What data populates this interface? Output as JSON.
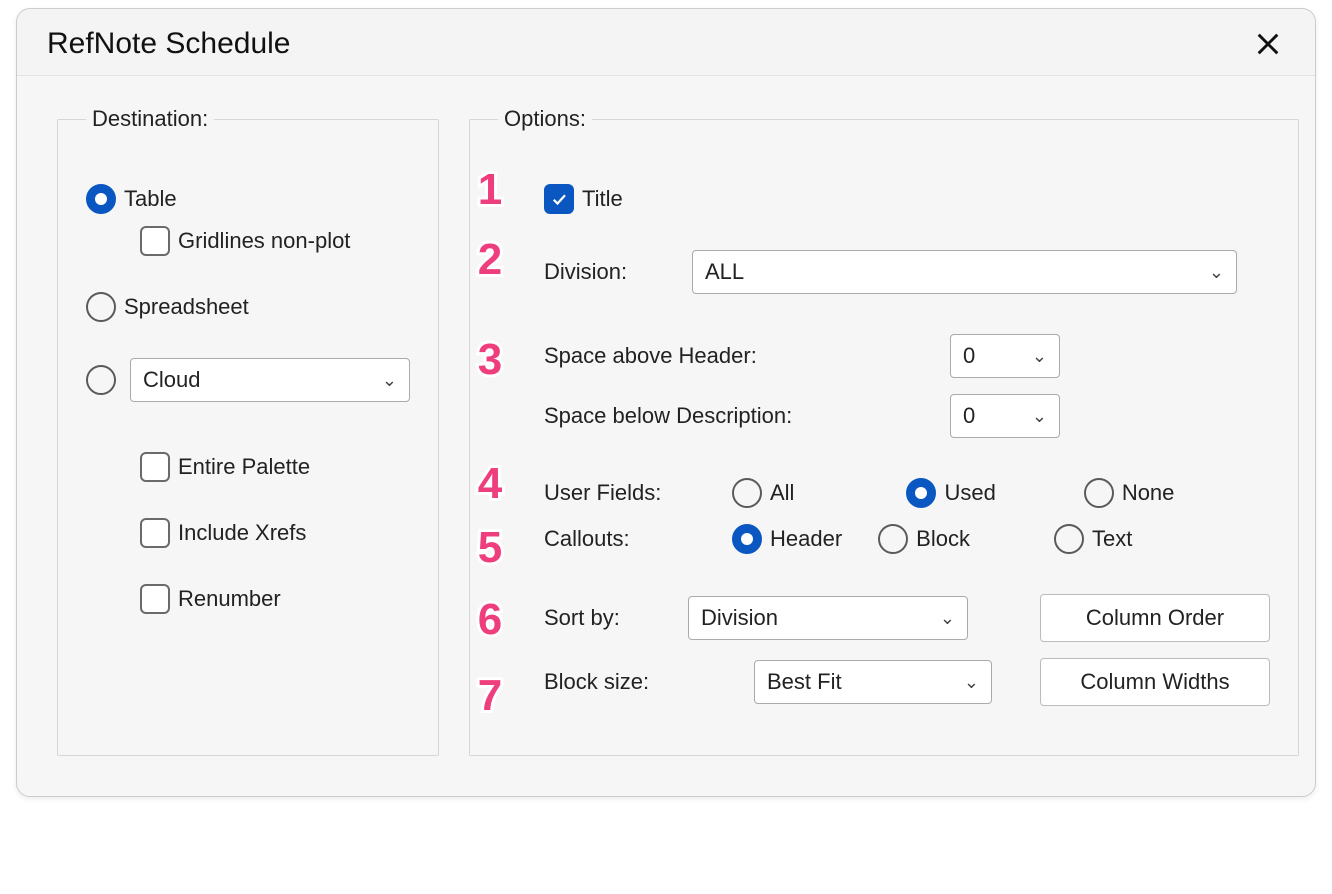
{
  "dialog": {
    "title": "RefNote Schedule"
  },
  "destination": {
    "legend": "Destination:",
    "table": "Table",
    "gridlines": "Gridlines non-plot",
    "spreadsheet": "Spreadsheet",
    "cloud_value": "Cloud",
    "entire_palette": "Entire Palette",
    "include_xrefs": "Include Xrefs",
    "renumber": "Renumber"
  },
  "options": {
    "legend": "Options:",
    "title_label": "Title",
    "division_label": "Division:",
    "division_value": "ALL",
    "space_above": "Space above Header:",
    "space_above_value": "0",
    "space_below": "Space below Description:",
    "space_below_value": "0",
    "user_fields_label": "User Fields:",
    "uf_all": "All",
    "uf_used": "Used",
    "uf_none": "None",
    "callouts_label": "Callouts:",
    "co_header": "Header",
    "co_block": "Block",
    "co_text": "Text",
    "sort_by_label": "Sort by:",
    "sort_by_value": "Division",
    "column_order_btn": "Column Order",
    "block_size_label": "Block size:",
    "block_size_value": "Best Fit",
    "column_widths_btn": "Column Widths"
  },
  "annotations": {
    "n1": "1",
    "n2": "2",
    "n3": "3",
    "n4": "4",
    "n5": "5",
    "n6": "6",
    "n7": "7"
  }
}
